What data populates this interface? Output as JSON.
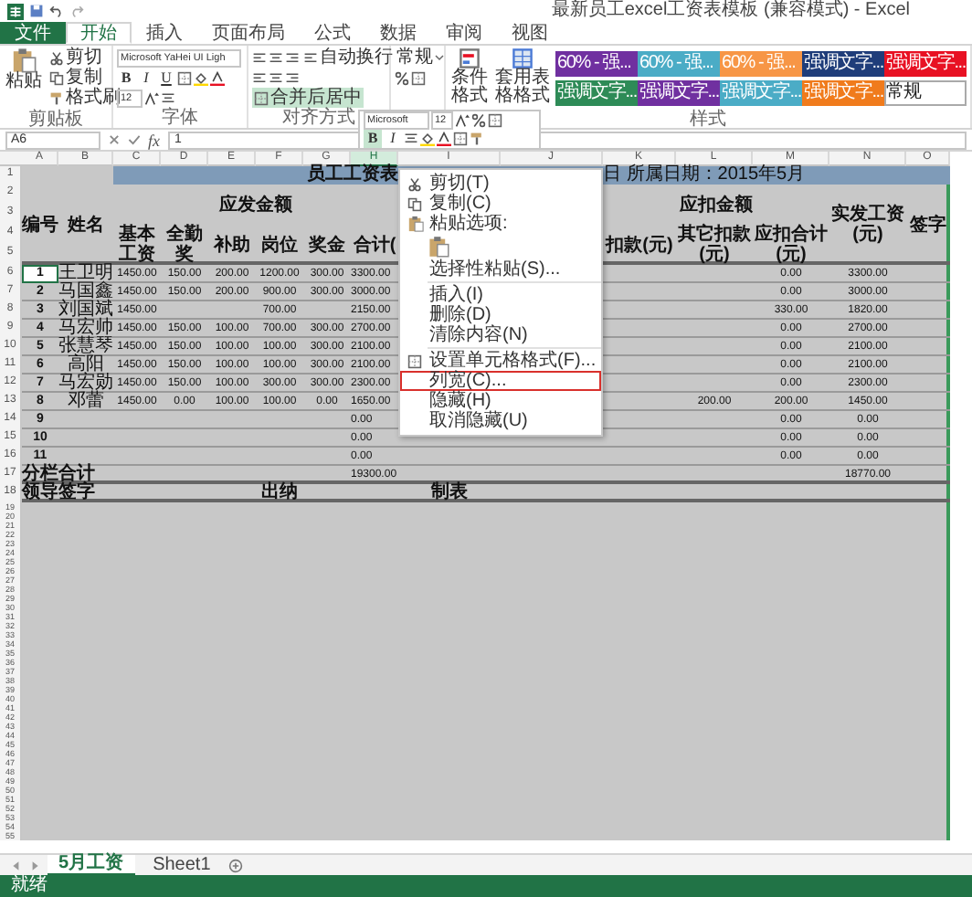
{
  "window": {
    "title": "最新员工excel工资表模板 (兼容模式) - Excel"
  },
  "ribbon": {
    "tabs": [
      {
        "label": "文件",
        "kind": "file",
        "selected": false
      },
      {
        "label": "开始",
        "kind": "tab",
        "selected": true
      },
      {
        "label": "插入",
        "kind": "tab",
        "selected": false
      },
      {
        "label": "页面布局",
        "kind": "tab",
        "selected": false
      },
      {
        "label": "公式",
        "kind": "tab",
        "selected": false
      },
      {
        "label": "数据",
        "kind": "tab",
        "selected": false
      },
      {
        "label": "审阅",
        "kind": "tab",
        "selected": false
      },
      {
        "label": "视图",
        "kind": "tab",
        "selected": false
      }
    ],
    "clipboard": {
      "paste": "粘贴",
      "cut": "剪切",
      "copy": "复制",
      "painter": "格式刷",
      "group": "剪贴板"
    },
    "font": {
      "name": "Microsoft YaHei UI Ligh",
      "size": "12",
      "bold": "B",
      "italic": "I",
      "underline": "U",
      "group": "字体"
    },
    "alignment": {
      "wrap": "自动换行",
      "merge": "合并后居中",
      "group": "对齐方式"
    },
    "number": {
      "format": "常规"
    },
    "styles": {
      "conditional": "条件格式",
      "table": "套用表格格式",
      "group": "样式",
      "swatches": [
        {
          "label": "60% - 强...",
          "color": "#7030a0"
        },
        {
          "label": "60% - 强...",
          "color": "#4bacc6"
        },
        {
          "label": "60% - 强...",
          "color": "#f79646"
        },
        {
          "label": "强调文字...",
          "color": "#1f3d7a"
        },
        {
          "label": "强调文字...",
          "color": "#e81123"
        },
        {
          "label": "强调文字...",
          "color": "#2e8b57"
        },
        {
          "label": "强调文字...",
          "color": "#7030a0"
        },
        {
          "label": "强调文字...",
          "color": "#4bacc6"
        },
        {
          "label": "强调文字...",
          "color": "#f07b1c"
        },
        {
          "label": "常规",
          "color": "#ffffff"
        }
      ]
    }
  },
  "formula_bar": {
    "name_box": "A6",
    "fx": "fx",
    "value": "1"
  },
  "mini_toolbar": {
    "font": "Microsoft",
    "size": "12",
    "bold": "B",
    "italic": "I"
  },
  "sheet": {
    "columns": [
      {
        "label": "A",
        "selected": false
      },
      {
        "label": "B",
        "selected": false
      },
      {
        "label": "C",
        "selected": false
      },
      {
        "label": "D",
        "selected": false
      },
      {
        "label": "E",
        "selected": false
      },
      {
        "label": "F",
        "selected": false
      },
      {
        "label": "G",
        "selected": false
      },
      {
        "label": "H",
        "selected": true
      },
      {
        "label": "I",
        "selected": false
      },
      {
        "label": "J",
        "selected": false
      },
      {
        "label": "K",
        "selected": false
      },
      {
        "label": "L",
        "selected": false
      },
      {
        "label": "M",
        "selected": false
      },
      {
        "label": "N",
        "selected": false
      },
      {
        "label": "O",
        "selected": false
      }
    ],
    "row_numbers": [
      "1",
      "2",
      "3",
      "4",
      "5",
      "6",
      "7",
      "8",
      "9",
      "10",
      "11",
      "12",
      "13",
      "14",
      "15",
      "16",
      "17",
      "18",
      "19",
      "20",
      "21",
      "22",
      "23",
      "24",
      "25",
      "26",
      "27",
      "28",
      "29",
      "30",
      "31",
      "32",
      "33",
      "34",
      "35",
      "36",
      "37",
      "38",
      "39",
      "40",
      "41",
      "42",
      "43",
      "44",
      "45",
      "46",
      "47",
      "48",
      "49",
      "50",
      "51",
      "52",
      "53",
      "54",
      "55"
    ],
    "title": "员工工资表",
    "date": "日 所属日期：2015年5月",
    "header": {
      "number": "编号",
      "name": "姓名",
      "payable": "应发金额",
      "deductions": "应扣金额",
      "net": "实发工资(元)",
      "sign": "签字",
      "payable_columns": [
        "基本工资",
        "全勤奖",
        "补助",
        "岗位",
        "奖金",
        "合计("
      ],
      "deduction_columns": [
        "扣款(元)",
        "其它扣款(元)",
        "应扣合计(元)"
      ]
    },
    "rows": [
      {
        "kind": "data",
        "selected": true,
        "no": "1",
        "name": "王卫明",
        "base": "1450.00",
        "attendance": "150.00",
        "subsidy": "200.00",
        "post": "1200.00",
        "bonus": "300.00",
        "total": "3300.00",
        "deduct_total": "0.00",
        "net": "3300.00"
      },
      {
        "kind": "data",
        "selected": false,
        "no": "2",
        "name": "马国鑫",
        "base": "1450.00",
        "attendance": "150.00",
        "subsidy": "200.00",
        "post": "900.00",
        "bonus": "300.00",
        "total": "3000.00",
        "deduct_total": "0.00",
        "net": "3000.00"
      },
      {
        "kind": "data",
        "selected": false,
        "no": "3",
        "name": "刘国斌",
        "base": "1450.00",
        "post": "700.00",
        "total": "2150.00",
        "deduct_total": "330.00",
        "net": "1820.00"
      },
      {
        "kind": "data",
        "selected": false,
        "no": "4",
        "name": "马宏帅",
        "base": "1450.00",
        "attendance": "150.00",
        "subsidy": "100.00",
        "post": "700.00",
        "bonus": "300.00",
        "total": "2700.00",
        "deduct_total": "0.00",
        "net": "2700.00"
      },
      {
        "kind": "data",
        "selected": false,
        "no": "5",
        "name": "张慧琴",
        "base": "1450.00",
        "attendance": "150.00",
        "subsidy": "100.00",
        "post": "100.00",
        "bonus": "300.00",
        "total": "2100.00",
        "deduct_total": "0.00",
        "net": "2100.00"
      },
      {
        "kind": "data",
        "selected": false,
        "no": "6",
        "name": "高阳",
        "base": "1450.00",
        "attendance": "150.00",
        "subsidy": "100.00",
        "post": "100.00",
        "bonus": "300.00",
        "total": "2100.00",
        "deduct_total": "0.00",
        "net": "2100.00"
      },
      {
        "kind": "data",
        "selected": false,
        "no": "7",
        "name": "马宏勋",
        "base": "1450.00",
        "attendance": "150.00",
        "subsidy": "100.00",
        "post": "300.00",
        "bonus": "300.00",
        "total": "2300.00",
        "deduct_total": "0.00",
        "net": "2300.00"
      },
      {
        "kind": "data",
        "selected": false,
        "no": "8",
        "name": "邓蕾",
        "base": "1450.00",
        "attendance": "0.00",
        "subsidy": "100.00",
        "post": "100.00",
        "bonus": "0.00",
        "total": "1650.00",
        "other": "200.00",
        "deduct_total": "200.00",
        "net": "1450.00"
      },
      {
        "kind": "data",
        "selected": false,
        "no": "9",
        "total": "0.00",
        "deduct_total": "0.00",
        "net": "0.00"
      },
      {
        "kind": "data",
        "selected": false,
        "no": "10",
        "total": "0.00",
        "deduct_total": "0.00",
        "net": "0.00"
      },
      {
        "kind": "data",
        "selected": false,
        "no": "11",
        "total": "0.00",
        "deduct_total": "0.00",
        "net": "0.00"
      },
      {
        "kind": "total",
        "selected": false,
        "label": "分栏合计",
        "total": "19300.00",
        "net": "18770.00"
      },
      {
        "kind": "signature",
        "selected": false,
        "label": "领导签字",
        "post": "出纳",
        "col_i": "制表"
      }
    ]
  },
  "context_menu": [
    {
      "kind": "cut",
      "label": "剪切(T)",
      "outlined": false
    },
    {
      "kind": "copy",
      "label": "复制(C)",
      "outlined": false
    },
    {
      "kind": "paste",
      "label": "粘贴选项:",
      "outlined": false
    },
    {
      "kind": "paste_icons"
    },
    {
      "kind": "plain",
      "label": "选择性粘贴(S)...",
      "outlined": false
    },
    {
      "kind": "separator"
    },
    {
      "kind": "plain",
      "label": "插入(I)",
      "outlined": false
    },
    {
      "kind": "plain",
      "label": "删除(D)",
      "outlined": false
    },
    {
      "kind": "plain",
      "label": "清除内容(N)",
      "outlined": false
    },
    {
      "kind": "separator"
    },
    {
      "kind": "format",
      "label": "设置单元格格式(F)...",
      "outlined": false
    },
    {
      "kind": "plain",
      "label": "列宽(C)...",
      "outlined": true
    },
    {
      "kind": "plain",
      "label": "隐藏(H)",
      "outlined": false
    },
    {
      "kind": "plain",
      "label": "取消隐藏(U)",
      "outlined": false
    }
  ],
  "sheet_tabs": [
    {
      "label": "5月工资",
      "selected": true
    },
    {
      "label": "Sheet1",
      "selected": false
    }
  ],
  "status_bar": "就绪"
}
